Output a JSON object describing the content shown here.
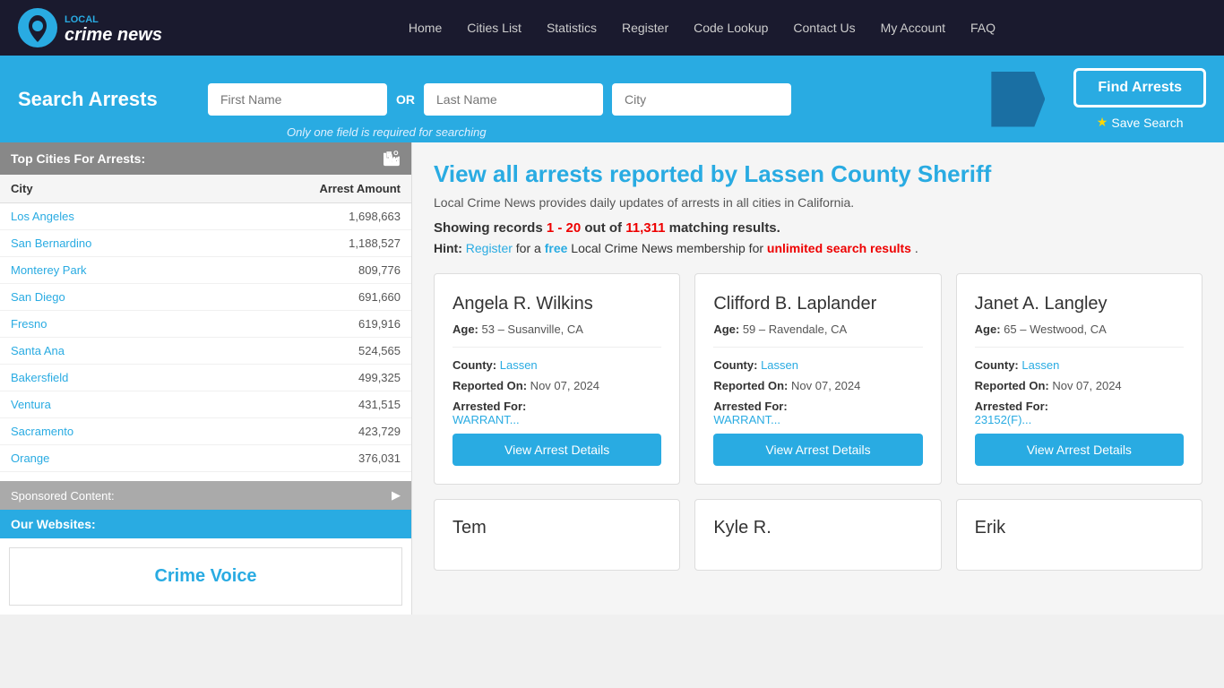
{
  "nav": {
    "links": [
      {
        "label": "Home",
        "href": "#"
      },
      {
        "label": "Cities List",
        "href": "#"
      },
      {
        "label": "Statistics",
        "href": "#"
      },
      {
        "label": "Register",
        "href": "#"
      },
      {
        "label": "Code Lookup",
        "href": "#"
      },
      {
        "label": "Contact Us",
        "href": "#"
      },
      {
        "label": "My Account",
        "href": "#"
      },
      {
        "label": "FAQ",
        "href": "#"
      }
    ]
  },
  "search": {
    "title": "Search Arrests",
    "first_name_placeholder": "First Name",
    "last_name_placeholder": "Last Name",
    "city_placeholder": "City",
    "or_text": "OR",
    "hint": "Only one field is required for searching",
    "find_button": "Find Arrests",
    "save_button": "Save Search"
  },
  "sidebar": {
    "top_cities_title": "Top Cities For Arrests:",
    "col_city": "City",
    "col_amount": "Arrest Amount",
    "cities": [
      {
        "name": "Los Angeles",
        "amount": "1,698,663"
      },
      {
        "name": "San Bernardino",
        "amount": "1,188,527"
      },
      {
        "name": "Monterey Park",
        "amount": "809,776"
      },
      {
        "name": "San Diego",
        "amount": "691,660"
      },
      {
        "name": "Fresno",
        "amount": "619,916"
      },
      {
        "name": "Santa Ana",
        "amount": "524,565"
      },
      {
        "name": "Bakersfield",
        "amount": "499,325"
      },
      {
        "name": "Ventura",
        "amount": "431,515"
      },
      {
        "name": "Sacramento",
        "amount": "423,729"
      },
      {
        "name": "Orange",
        "amount": "376,031"
      }
    ],
    "sponsored_title": "Sponsored Content:",
    "our_websites_title": "Our Websites:",
    "crime_voice_label": "Crime Voice"
  },
  "content": {
    "page_title": "View all arrests reported by Lassen County Sheriff",
    "subtitle": "Local Crime News provides daily updates of arrests in all cities in California.",
    "results_showing": "Showing records ",
    "results_range": "1 - 20",
    "results_out_of": " out of ",
    "results_count": "11,311",
    "results_suffix": " matching results.",
    "hint_prefix": "Hint: ",
    "hint_register": "Register",
    "hint_for": " for a ",
    "hint_free": "free",
    "hint_membership": " Local Crime News membership for ",
    "hint_unlimited": "unlimited search results",
    "hint_end": ".",
    "cards": [
      {
        "name": "Angela R. Wilkins",
        "age": "53",
        "location": "Susanville, CA",
        "county": "Lassen",
        "reported_on": "Nov 07, 2024",
        "arrested_for": "WARRANT...",
        "button": "View Arrest Details"
      },
      {
        "name": "Clifford B. Laplander",
        "age": "59",
        "location": "Ravendale, CA",
        "county": "Lassen",
        "reported_on": "Nov 07, 2024",
        "arrested_for": "WARRANT...",
        "button": "View Arrest Details"
      },
      {
        "name": "Janet A. Langley",
        "age": "65",
        "location": "Westwood, CA",
        "county": "Lassen",
        "reported_on": "Nov 07, 2024",
        "arrested_for": "23152(F)...",
        "button": "View Arrest Details"
      }
    ],
    "partial_cards": [
      {
        "name": "Tem"
      },
      {
        "name": "Kyle R."
      },
      {
        "name": "Erik"
      }
    ]
  }
}
